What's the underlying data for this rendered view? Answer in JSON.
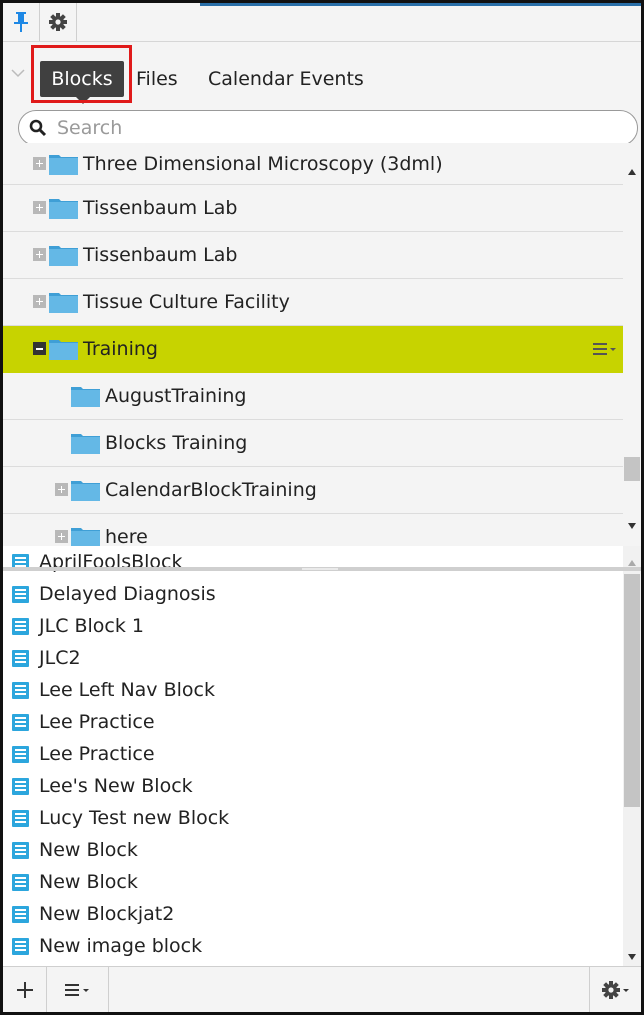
{
  "toolbar": {
    "pin_icon": "pin-icon",
    "settings_icon": "gear-icon",
    "accent_color": "#2a6fa8"
  },
  "tabs": {
    "items": [
      {
        "label": "Blocks",
        "active": true
      },
      {
        "label": "Files",
        "active": false
      },
      {
        "label": "Calendar Events",
        "active": false
      }
    ],
    "highlight_color": "#e01a1a"
  },
  "search": {
    "placeholder": "Search",
    "value": ""
  },
  "tree": {
    "selected_color": "#c7d300",
    "folder_color": "#64b8e6",
    "items": [
      {
        "label": "Three Dimensional Microscopy (3dml)",
        "level": 0,
        "expander": "plus"
      },
      {
        "label": "Tissenbaum Lab",
        "level": 0,
        "expander": "plus"
      },
      {
        "label": "Tissenbaum Lab",
        "level": 0,
        "expander": "plus"
      },
      {
        "label": "Tissue Culture Facility",
        "level": 0,
        "expander": "plus"
      },
      {
        "label": "Training",
        "level": 0,
        "expander": "minus",
        "selected": true
      },
      {
        "label": "AugustTraining",
        "level": 1,
        "expander": "none"
      },
      {
        "label": "Blocks Training",
        "level": 1,
        "expander": "none"
      },
      {
        "label": "CalendarBlockTraining",
        "level": 1,
        "expander": "plus"
      },
      {
        "label": "here",
        "level": 1,
        "expander": "plus"
      }
    ]
  },
  "blocks": {
    "icon_color": "#2ca6dd",
    "items": [
      "AprilFoolsBlock",
      "Delayed Diagnosis",
      "JLC Block 1",
      "JLC2",
      "Lee Left Nav Block",
      "Lee Practice",
      "Lee Practice",
      "Lee's New Block",
      "Lucy Test new Block",
      "New Block",
      "New Block",
      "New Blockjat2",
      "New image block"
    ]
  },
  "bottombar": {
    "add_icon": "plus-icon",
    "menu_icon": "menu-icon",
    "settings_icon": "gear-icon"
  }
}
